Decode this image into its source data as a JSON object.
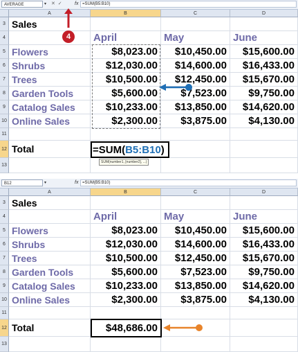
{
  "colors": {
    "label": "#6e6aa8",
    "range_blue": "#1f6fb5",
    "arrow_blue": "#1f6fb5",
    "arrow_orange": "#e8842b",
    "step_red": "#c31e28"
  },
  "step_badge": "4",
  "panel1": {
    "name_box": "AVERAGE",
    "formula_buttons": "✕ ✓",
    "fx": "fx",
    "formula": "=SUM(B5:B10)",
    "columns": [
      "A",
      "B",
      "C",
      "D"
    ],
    "rows": [
      "3",
      "4",
      "5",
      "6",
      "7",
      "8",
      "9",
      "10",
      "11",
      "12",
      "13"
    ],
    "title": "Sales",
    "months": [
      "April",
      "May",
      "June"
    ],
    "items": [
      {
        "name": "Flowers",
        "april": "$8,023.00",
        "may": "$10,450.00",
        "june": "$15,600.00"
      },
      {
        "name": "Shrubs",
        "april": "$12,030.00",
        "may": "$14,600.00",
        "june": "$16,433.00"
      },
      {
        "name": "Trees",
        "april": "$10,500.00",
        "may": "$12,450.00",
        "june": "$15,670.00"
      },
      {
        "name": "Garden Tools",
        "april": "$5,600.00",
        "may": "$7,523.00",
        "june": "$9,750.00"
      },
      {
        "name": "Catalog Sales",
        "april": "$10,233.00",
        "may": "$13,850.00",
        "june": "$14,620.00"
      },
      {
        "name": "Online Sales",
        "april": "$2,300.00",
        "may": "$3,875.00",
        "june": "$4,130.00"
      }
    ],
    "total_label": "Total",
    "edit_prefix": "=SUM(",
    "edit_range": "B5:B10",
    "edit_suffix": ")",
    "tooltip": "SUM(number1, [number2], ...)"
  },
  "panel2": {
    "name_box": "B12",
    "fx": "fx",
    "formula": "=SUM(B5:B10)",
    "columns": [
      "A",
      "B",
      "C",
      "D"
    ],
    "rows": [
      "3",
      "4",
      "5",
      "6",
      "7",
      "8",
      "9",
      "10",
      "11",
      "12",
      "13"
    ],
    "title": "Sales",
    "months": [
      "April",
      "May",
      "June"
    ],
    "items": [
      {
        "name": "Flowers",
        "april": "$8,023.00",
        "may": "$10,450.00",
        "june": "$15,600.00"
      },
      {
        "name": "Shrubs",
        "april": "$12,030.00",
        "may": "$14,600.00",
        "june": "$16,433.00"
      },
      {
        "name": "Trees",
        "april": "$10,500.00",
        "may": "$12,450.00",
        "june": "$15,670.00"
      },
      {
        "name": "Garden Tools",
        "april": "$5,600.00",
        "may": "$7,523.00",
        "june": "$9,750.00"
      },
      {
        "name": "Catalog Sales",
        "april": "$10,233.00",
        "may": "$13,850.00",
        "june": "$14,620.00"
      },
      {
        "name": "Online Sales",
        "april": "$2,300.00",
        "may": "$3,875.00",
        "june": "$4,130.00"
      }
    ],
    "total_label": "Total",
    "total_value": "$48,686.00"
  }
}
